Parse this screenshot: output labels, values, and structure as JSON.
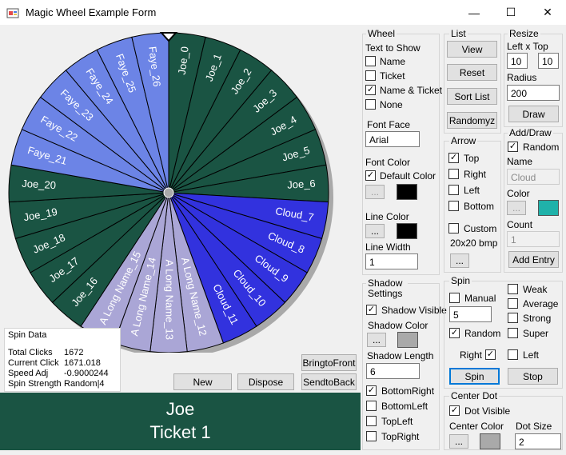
{
  "window": {
    "title": "Magic Wheel Example Form",
    "minimize": "—",
    "maximize": "☐",
    "close": "✕"
  },
  "wheel_labels": [
    "Joe_0",
    "Joe_1",
    "Joe_2",
    "Joe_3",
    "Joe_4",
    "Joe_5",
    "Joe_6",
    "Cloud_7",
    "Cloud_8",
    "Cloud_9",
    "Cloud_10",
    "Cloud_11",
    "A Long Name_12",
    "A Long Name_13",
    "A Long Name_14",
    "A Long Name_15",
    "Joe_16",
    "Joe_17",
    "Joe_18",
    "Joe_19",
    "Joe_20",
    "Faye_21",
    "Faye_22",
    "Faye_23",
    "Faye_24",
    "Faye_25",
    "Faye_26"
  ],
  "colors": {
    "joe": "#1a5443",
    "cloud": "#3232de",
    "long": "#aaa6d6",
    "faye": "#6c84e6",
    "shadow": "#a9a9a9",
    "banner": "#1a5443",
    "teal": "#20b2aa"
  },
  "wheel_group": {
    "title": "Wheel",
    "text_to_show": "Text to Show",
    "opts": [
      "Name",
      "Ticket",
      "Name & Ticket",
      "None"
    ],
    "font_face_label": "Font Face",
    "font_face": "Arial",
    "font_color_label": "Font Color",
    "default_color": "Default Color",
    "dots": "...",
    "line_color_label": "Line Color",
    "line_width_label": "Line Width",
    "line_width": "1"
  },
  "list_group": {
    "title": "List",
    "view": "View",
    "reset": "Reset",
    "sort": "Sort List",
    "randomize": "Randomyz"
  },
  "resize_group": {
    "title": "Resize",
    "left_top": "Left x Top",
    "left": "10",
    "top": "10",
    "radius_label": "Radius",
    "radius": "200",
    "draw": "Draw"
  },
  "arrow_group": {
    "title": "Arrow",
    "opts": [
      "Top",
      "Right",
      "Left",
      "Bottom"
    ],
    "custom": "Custom",
    "size": "20x20 bmp",
    "dots": "..."
  },
  "add_group": {
    "title": "Add/Draw",
    "random": "Random",
    "name_label": "Name",
    "name": "Cloud",
    "color_label": "Color",
    "count_label": "Count",
    "count": "1",
    "add": "Add Entry"
  },
  "shadow_group": {
    "title": "Shadow Settings",
    "visible": "Shadow Visible",
    "color_label": "Shadow Color",
    "dots": "...",
    "length_label": "Shadow Length",
    "length": "6",
    "opts": [
      "BottomRight",
      "BottomLeft",
      "TopLeft",
      "TopRight"
    ]
  },
  "spin_group": {
    "title": "Spin",
    "manual": "Manual",
    "value": "5",
    "random": "Random",
    "weak": "Weak",
    "average": "Average",
    "strong": "Strong",
    "super": "Super",
    "right": "Right",
    "left": "Left",
    "spin": "Spin",
    "stop": "Stop"
  },
  "center_group": {
    "title": "Center Dot",
    "visible": "Dot Visible",
    "color_label": "Center Color",
    "dots": "...",
    "size_label": "Dot Size",
    "size": "2"
  },
  "spin_data": {
    "title": "Spin Data",
    "rows": [
      {
        "k": "Total Clicks",
        "v": "1672"
      },
      {
        "k": "Current Click",
        "v": "1671.018"
      },
      {
        "k": "Speed Adj",
        "v": "-0.9000244"
      },
      {
        "k": "Spin Strength",
        "v": "Random|4"
      }
    ]
  },
  "buttons": {
    "new": "New",
    "dispose": "Dispose",
    "bring": "BringtoFront",
    "send": "SendtoBack"
  },
  "banner": {
    "line1": "Joe",
    "line2": "Ticket 1"
  }
}
